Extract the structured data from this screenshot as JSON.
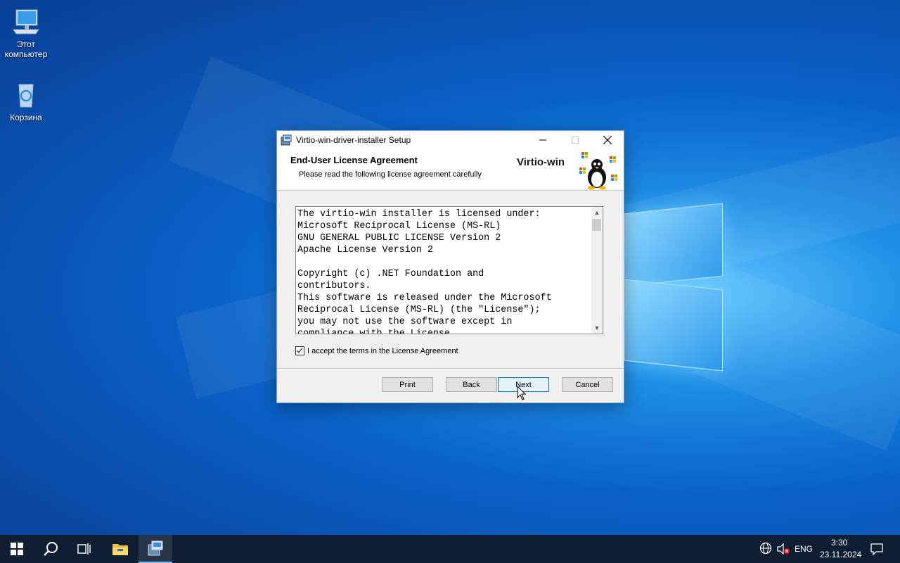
{
  "desktop": {
    "icons": [
      {
        "label_line1": "Этот",
        "label_line2": "компьютер",
        "icon": "computer-icon"
      },
      {
        "label_line1": "Корзина",
        "label_line2": "",
        "icon": "recycle-bin-icon"
      }
    ]
  },
  "dialog": {
    "title": "Virtio-win-driver-installer Setup",
    "header_title": "End-User License Agreement",
    "header_subtitle": "Please read the following license agreement carefully",
    "brand": "Virtio-win",
    "license_text": "The virtio-win installer is licensed under:\nMicrosoft Reciprocal License (MS-RL)\nGNU GENERAL PUBLIC LICENSE Version 2\nApache License Version 2\n\nCopyright (c) .NET Foundation and\ncontributors.\nThis software is released under the Microsoft\nReciprocal License (MS-RL) (the \"License\");\nyou may not use the software except in\ncompliance with the License.",
    "accept_label": "I accept the terms in the License Agreement",
    "accept_checked": true,
    "buttons": {
      "print": "Print",
      "back": "Back",
      "next": "Next",
      "cancel": "Cancel"
    }
  },
  "taskbar": {
    "items": [
      "start-icon",
      "search-icon",
      "task-view-icon",
      "file-explorer-icon",
      "installer-icon"
    ],
    "language": "ENG",
    "time": "3:30",
    "date": "23.11.2024"
  }
}
